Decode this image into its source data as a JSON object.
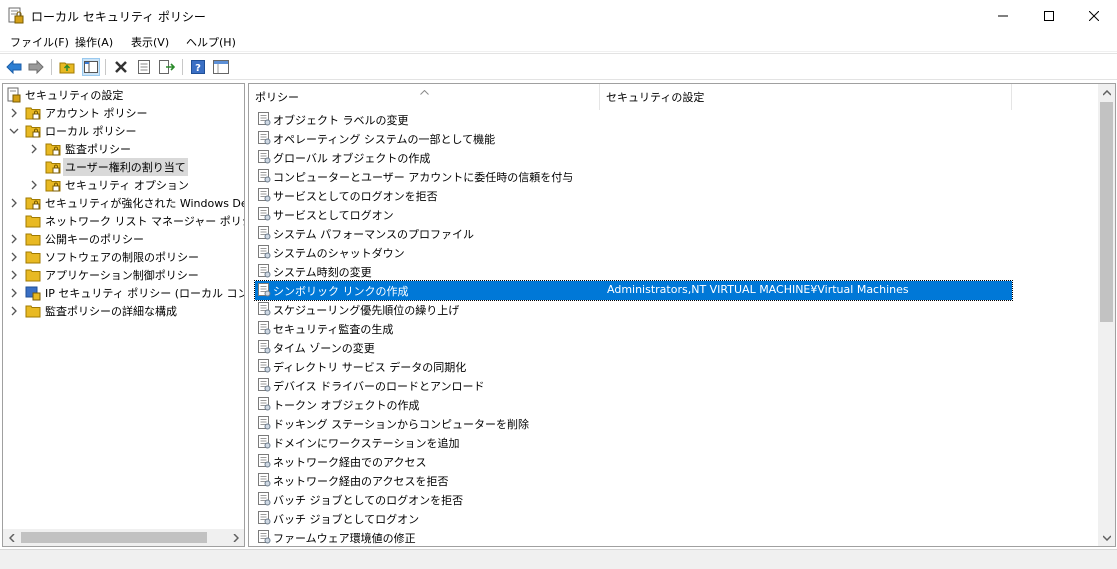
{
  "window": {
    "title": "ローカル セキュリティ ポリシー",
    "controls": [
      "minimize",
      "maximize",
      "close"
    ]
  },
  "menu": {
    "items": [
      "ファイル(F)",
      "操作(A)",
      "表示(V)",
      "ヘルプ(H)"
    ]
  },
  "toolbar": {
    "icons": [
      "back-icon",
      "forward-icon",
      "up-folder-icon",
      "show-hide-tree-icon",
      "delete-icon",
      "properties-icon",
      "export-list-icon",
      "help-icon",
      "view-icon"
    ]
  },
  "tree": {
    "root": "セキュリティの設定",
    "items": [
      {
        "label": "アカウント ポリシー",
        "level": 1,
        "expanded": false
      },
      {
        "label": "ローカル ポリシー",
        "level": 1,
        "expanded": true
      },
      {
        "label": "監査ポリシー",
        "level": 2,
        "expanded": false
      },
      {
        "label": "ユーザー権利の割り当て",
        "level": 2,
        "selected": true
      },
      {
        "label": "セキュリティ オプション",
        "level": 2,
        "expanded": false
      },
      {
        "label": "セキュリティが強化された Windows Defer",
        "level": 1,
        "expanded": false
      },
      {
        "label": "ネットワーク リスト マネージャー ポリシー",
        "level": 1
      },
      {
        "label": "公開キーのポリシー",
        "level": 1,
        "expanded": false
      },
      {
        "label": "ソフトウェアの制限のポリシー",
        "level": 1,
        "expanded": false
      },
      {
        "label": "アプリケーション制御ポリシー",
        "level": 1,
        "expanded": false
      },
      {
        "label": "IP セキュリティ ポリシー (ローカル コンピュータ",
        "level": 1,
        "expanded": false
      },
      {
        "label": "監査ポリシーの詳細な構成",
        "level": 1,
        "expanded": false
      }
    ]
  },
  "list": {
    "columns": [
      "ポリシー",
      "セキュリティの設定"
    ],
    "rows": [
      {
        "policy": "オブジェクト ラベルの変更",
        "setting": ""
      },
      {
        "policy": "オペレーティング システムの一部として機能",
        "setting": ""
      },
      {
        "policy": "グローバル オブジェクトの作成",
        "setting": ""
      },
      {
        "policy": "コンピューターとユーザー アカウントに委任時の信頼を付与",
        "setting": ""
      },
      {
        "policy": "サービスとしてのログオンを拒否",
        "setting": ""
      },
      {
        "policy": "サービスとしてログオン",
        "setting": ""
      },
      {
        "policy": "システム パフォーマンスのプロファイル",
        "setting": ""
      },
      {
        "policy": "システムのシャットダウン",
        "setting": ""
      },
      {
        "policy": "システム時刻の変更",
        "setting": ""
      },
      {
        "policy": "シンボリック リンクの作成",
        "setting": "Administrators,NT VIRTUAL MACHINE¥Virtual Machines",
        "selected": true
      },
      {
        "policy": "スケジューリング優先順位の繰り上げ",
        "setting": ""
      },
      {
        "policy": "セキュリティ監査の生成",
        "setting": ""
      },
      {
        "policy": "タイム ゾーンの変更",
        "setting": ""
      },
      {
        "policy": "ディレクトリ サービス データの同期化",
        "setting": ""
      },
      {
        "policy": "デバイス ドライバーのロードとアンロード",
        "setting": ""
      },
      {
        "policy": "トークン オブジェクトの作成",
        "setting": ""
      },
      {
        "policy": "ドッキング ステーションからコンピューターを削除",
        "setting": ""
      },
      {
        "policy": "ドメインにワークステーションを追加",
        "setting": ""
      },
      {
        "policy": "ネットワーク経由でのアクセス",
        "setting": ""
      },
      {
        "policy": "ネットワーク経由のアクセスを拒否",
        "setting": ""
      },
      {
        "policy": "バッチ ジョブとしてのログオンを拒否",
        "setting": ""
      },
      {
        "policy": "バッチ ジョブとしてログオン",
        "setting": ""
      },
      {
        "policy": "ファームウェア環境値の修正",
        "setting": ""
      }
    ]
  },
  "colors": {
    "selection": "#0078d7",
    "tree_selection": "#d9d9d9",
    "folder": "#e8b923"
  }
}
